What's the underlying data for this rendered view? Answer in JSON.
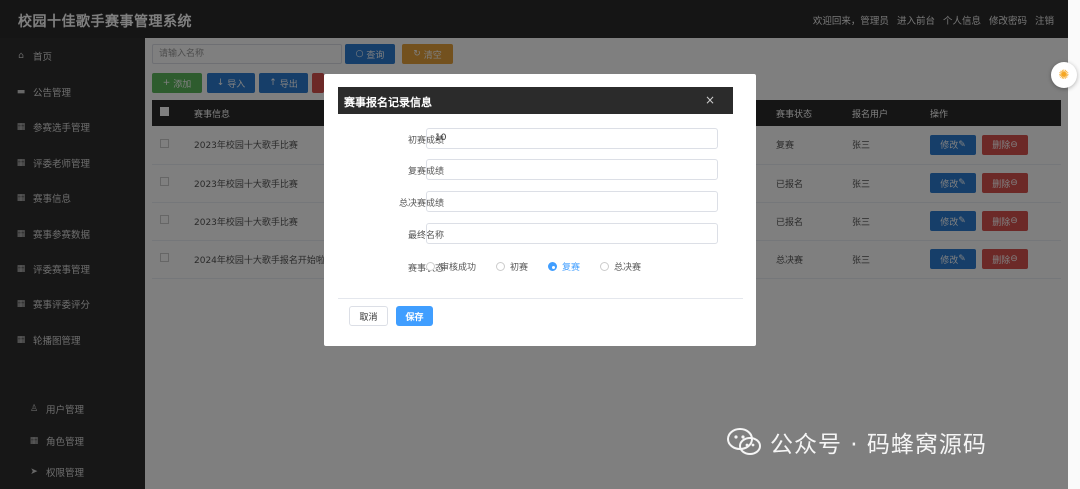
{
  "header": {
    "title": "校园十佳歌手赛事管理系统",
    "links": [
      "欢迎回来，管理员",
      "进入前台",
      "个人信息",
      "修改密码",
      "注销"
    ]
  },
  "sidebar": {
    "items": [
      {
        "label": "首页",
        "icon": "home-icon"
      },
      {
        "label": "公告管理",
        "icon": "message-icon"
      },
      {
        "label": "参赛选手管理",
        "icon": "grid-icon"
      },
      {
        "label": "评委老师管理",
        "icon": "grid-icon"
      },
      {
        "label": "赛事信息",
        "icon": "grid-icon"
      },
      {
        "label": "赛事参赛数据",
        "icon": "grid-icon"
      },
      {
        "label": "评委赛事管理",
        "icon": "grid-icon"
      },
      {
        "label": "赛事评委评分",
        "icon": "grid-icon"
      },
      {
        "label": "轮播图管理",
        "icon": "grid-icon"
      }
    ],
    "sub_items": [
      {
        "label": "用户管理",
        "icon": "user-icon"
      },
      {
        "label": "角色管理",
        "icon": "grid-icon"
      },
      {
        "label": "权限管理",
        "icon": "send-icon"
      }
    ]
  },
  "toolbar": {
    "search_placeholder": "请输入名称",
    "query_label": "查询",
    "clear_label": "清空",
    "add_label": "添加",
    "import_label": "导入",
    "export_label": "导出"
  },
  "table": {
    "headers": {
      "info": "赛事信息",
      "status": "赛事状态",
      "user": "报名用户",
      "ops": "操作"
    },
    "rows": [
      {
        "info": "2023年校园十大歌手比赛",
        "status": "复赛",
        "user": "张三"
      },
      {
        "info": "2023年校园十大歌手比赛",
        "status": "已报名",
        "user": "张三"
      },
      {
        "info": "2023年校园十大歌手比赛",
        "status": "已报名",
        "user": "张三"
      },
      {
        "info": "2024年校园十大歌手报名开始啦",
        "status": "总决赛",
        "user": "张三"
      }
    ],
    "edit_label": "修改",
    "delete_label": "删除"
  },
  "dialog": {
    "title": "赛事报名记录信息",
    "close": "×",
    "fields": [
      {
        "label": "初赛成绩",
        "value": "10"
      },
      {
        "label": "复赛成绩",
        "value": ""
      },
      {
        "label": "总决赛成绩",
        "value": ""
      },
      {
        "label": "最终名称",
        "value": ""
      }
    ],
    "status_label": "赛事状态",
    "status_options": [
      "审核成功",
      "初赛",
      "复赛",
      "总决赛"
    ],
    "status_selected": "复赛",
    "cancel_label": "取消",
    "save_label": "保存"
  },
  "watermark": "公众号 · 码蜂窝源码",
  "colors": {
    "primary": "#409eff",
    "header": "#2b2b2b",
    "sidebar": "#2e2e2e",
    "danger": "#d9534f",
    "warning": "#e6a23c",
    "success": "#5cb85c"
  }
}
